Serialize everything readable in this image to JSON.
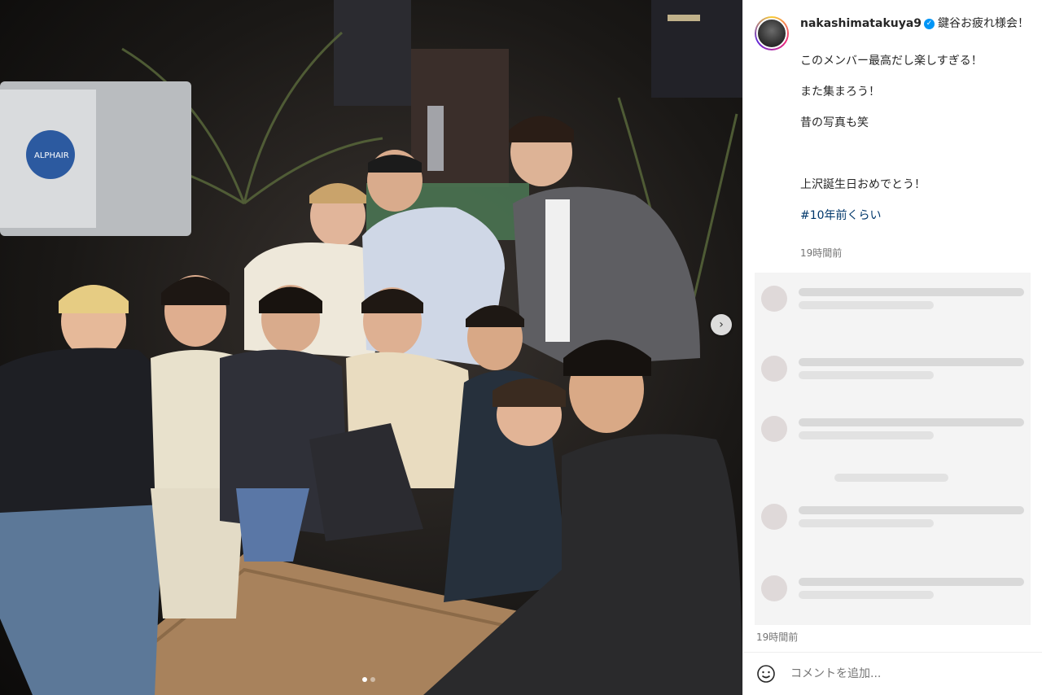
{
  "post": {
    "username": "nakashimatakuya9",
    "verified": true,
    "caption_title": "鍵谷お疲れ様会！",
    "caption_lines": [
      "このメンバー最高だし楽しすぎる！",
      "また集まろう！",
      "昔の写真も笑",
      "",
      "上沢誕生日おめでとう！"
    ],
    "hashtag": "#10年前くらい",
    "time_caption": "19時間前",
    "time_bottom": "19時間前",
    "comment_placeholder": "コメントを追加..."
  },
  "media": {
    "description_icon": "group-photo",
    "carousel_index": 1,
    "carousel_count": 2,
    "next_icon": "chevron-right-icon",
    "sign_text": "ALPHAIR"
  },
  "colors": {
    "verified": "#0095f6",
    "hashtag": "#00376b",
    "muted": "#737373"
  }
}
